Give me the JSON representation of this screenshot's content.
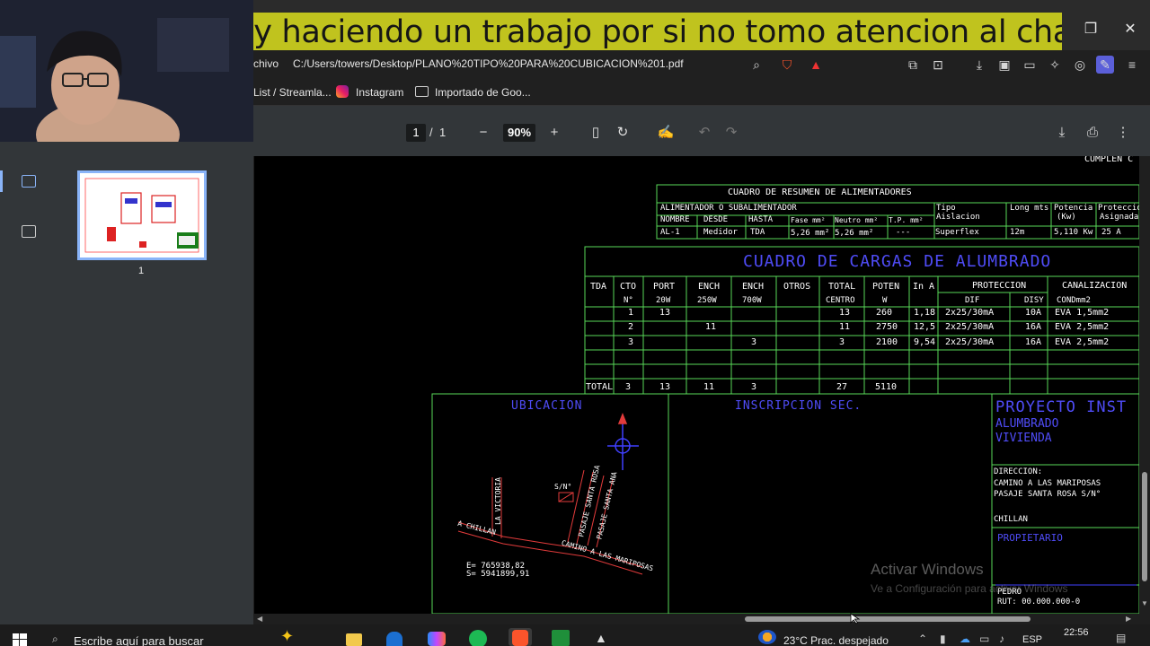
{
  "caption": "Estoy haciendo un trabajo por si no tomo atencion al chat",
  "address": {
    "tab_fragment": "chivo",
    "url": "C:/Users/towers/Desktop/PLANO%20TIPO%20PARA%20CUBICACION%201.pdf"
  },
  "bookmarks": [
    {
      "label": "List / Streamla..."
    },
    {
      "label": "Instagram"
    },
    {
      "label": "Importado de Goo..."
    }
  ],
  "pdf_toolbar": {
    "page_current": "1",
    "page_sep": "/",
    "page_total": "1",
    "zoom": "90%"
  },
  "sidebar": {
    "thumb_label": "1"
  },
  "drawing": {
    "top_right_fragment": "CUMPLEN C",
    "summary": {
      "title": "CUADRO DE RESUMEN DE ALIMENTADORES",
      "group_label": "ALIMENTADOR O SUBALIMENTADOR",
      "tipo_label": "Tipo",
      "aislacion_label": "Aislacion",
      "long_label": "Long mts",
      "potencia_label": "Potencia",
      "kw_label": "(Kw)",
      "proteccion_label": "Proteccion",
      "asignada_label": "Asignada",
      "headers": [
        "NOMBRE",
        "DESDE",
        "HASTA",
        "Fase mm²",
        "Neutro mm²",
        "T.P. mm²"
      ],
      "row": [
        "AL-1",
        "Medidor",
        "TDA",
        "5,26 mm²",
        "5,26 mm²",
        "---",
        "Superflex",
        "12m",
        "5,110 Kw",
        "25 A"
      ]
    },
    "loads": {
      "title": "CUADRO DE CARGAS DE ALUMBRADO",
      "headers_top": [
        "TDA",
        "CTO",
        "PORT",
        "ENCH",
        "ENCH",
        "OTROS",
        "TOTAL",
        "POTEN",
        "In A",
        "PROTECCION",
        "CANALIZACION"
      ],
      "headers_bottom": [
        "N°",
        "20W",
        "250W",
        "700W",
        "CENTRO",
        "W",
        "DIF",
        "DISY",
        "CONDmm2"
      ],
      "rows": [
        [
          "1",
          "13",
          "",
          "",
          "13",
          "260",
          "1,18",
          "2x25/30mA",
          "10A",
          "EVA 1,5mm2"
        ],
        [
          "2",
          "",
          "11",
          "",
          "11",
          "2750",
          "12,5",
          "2x25/30mA",
          "16A",
          "EVA 2,5mm2"
        ],
        [
          "3",
          "",
          "",
          "3",
          "3",
          "2100",
          "9,54",
          "2x25/30mA",
          "16A",
          "EVA 2,5mm2"
        ]
      ],
      "total": [
        "TOTAL",
        "3",
        "13",
        "11",
        "3",
        "27",
        "5110"
      ]
    },
    "ubicacion": {
      "title": "UBICACION",
      "street_chillan": "A CHILLAN",
      "street_victoria": "LA VICTORIA",
      "street_santa_rosa": "PASAJE SANTA ROSA",
      "street_santa_ana": "PASAJE SANTA ANA",
      "street_camino": "CAMINO A LAS MARIPOSAS",
      "sn_label": "S/N°",
      "coord_e": "E= 765938,82",
      "coord_s": "S= 5941899,91"
    },
    "inscripcion": "INSCRIPCION SEC.",
    "proyecto": {
      "title": "PROYECTO INST",
      "line1": "ALUMBRADO",
      "line2": "VIVIENDA",
      "direccion_label": "DIRECCION:",
      "direccion1": "CAMINO A LAS MARIPOSAS",
      "direccion2": "PASAJE SANTA ROSA S/N°",
      "ciudad": "CHILLAN",
      "propietario_label": "PROPIETARIO",
      "propietario_nombre": "PEDRO",
      "rut": "RUT: 00.000.000-0"
    },
    "watermark1": "Activar Windows",
    "watermark2": "Ve a Configuración para activar Windows"
  },
  "taskbar": {
    "search_placeholder": "Escribe aquí para buscar",
    "weather": "23°C  Prac. despejado",
    "lang": "ESP",
    "time": "22:56"
  },
  "colors": {
    "caption_bg": "#c0c31e",
    "cad_green": "#58d858",
    "cad_blue": "#4f4cf7",
    "accent": "#8ab4f8"
  }
}
